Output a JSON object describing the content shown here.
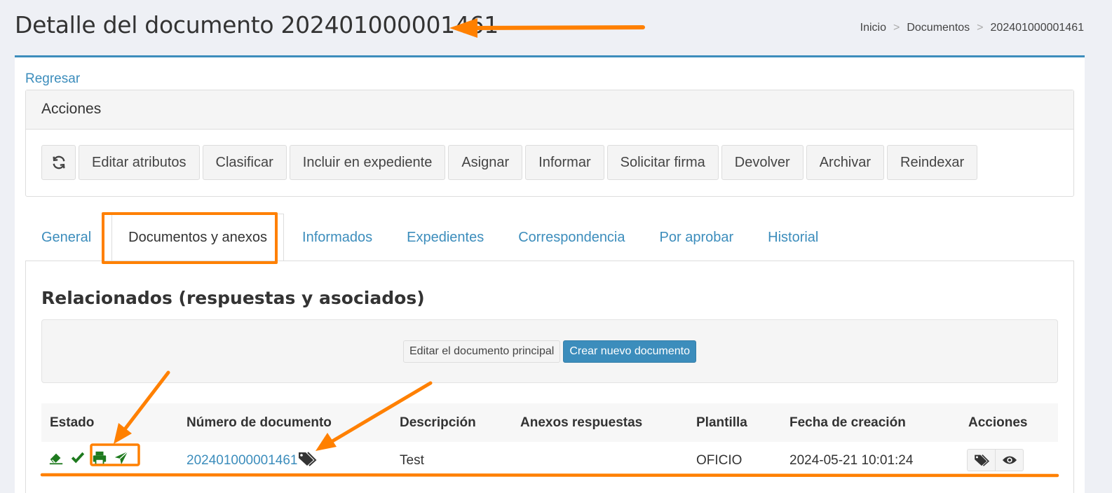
{
  "header": {
    "title": "Detalle del documento 202401000001461",
    "breadcrumb": [
      "Inicio",
      "Documentos",
      "202401000001461"
    ]
  },
  "back_link": "Regresar",
  "actions": {
    "title": "Acciones",
    "buttons": [
      "Editar atributos",
      "Clasificar",
      "Incluir en expediente",
      "Asignar",
      "Informar",
      "Solicitar firma",
      "Devolver",
      "Archivar",
      "Reindexar"
    ]
  },
  "tabs": [
    {
      "label": "General"
    },
    {
      "label": "Documentos y anexos"
    },
    {
      "label": "Informados"
    },
    {
      "label": "Expedientes"
    },
    {
      "label": "Correspondencia"
    },
    {
      "label": "Por aprobar"
    },
    {
      "label": "Historial"
    }
  ],
  "related": {
    "title": "Relacionados (respuestas y asociados)",
    "edit_main_label": "Editar el documento principal",
    "create_new_label": "Crear nuevo documento"
  },
  "table": {
    "headers": [
      "Estado",
      "Número de documento",
      "Descripción",
      "Anexos respuestas",
      "Plantilla",
      "Fecha de creación",
      "Acciones"
    ],
    "row": {
      "numero": "202401000001461",
      "descripcion": "Test",
      "plantilla": "OFICIO",
      "fecha": "2024-05-21 10:01:24"
    }
  },
  "colors": {
    "accent": "#3c8dbc",
    "annotation": "#ff8000",
    "status_green": "#1e7a1e"
  }
}
